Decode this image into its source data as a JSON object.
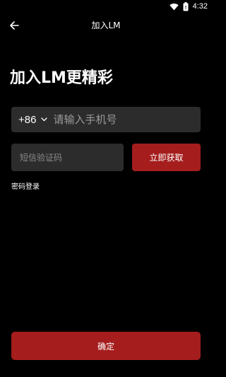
{
  "status_bar": {
    "time": "4:32",
    "icons": [
      "wifi-icon",
      "battery-icon"
    ]
  },
  "header": {
    "title": "加入LM",
    "back_icon": "arrow-left-icon"
  },
  "main": {
    "headline": "加入LM更精彩",
    "phone": {
      "country_code": "+86",
      "placeholder": "请输入手机号",
      "value": ""
    },
    "sms_code": {
      "placeholder": "短信验证码",
      "value": ""
    },
    "get_code_label": "立即获取",
    "password_login_label": "密码登录"
  },
  "footer": {
    "confirm_label": "确定"
  },
  "colors": {
    "background": "#000000",
    "field_bg": "#2c2c2c",
    "accent": "#a51d1d",
    "text": "#ffffff",
    "placeholder": "#9a9a9a"
  }
}
